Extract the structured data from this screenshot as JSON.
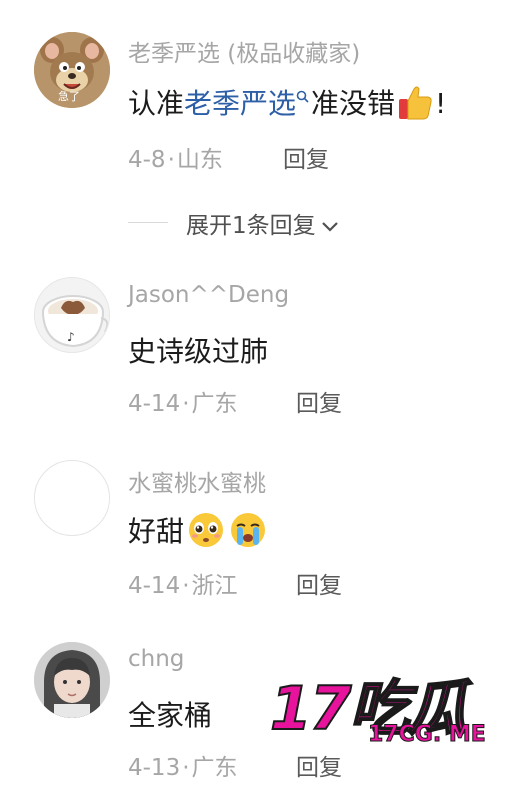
{
  "comments": [
    {
      "username": "老季严选 (极品收藏家)",
      "text_pre": "认准",
      "text_link": "老季严选",
      "text_post": "准没错",
      "text_end": "!",
      "date": "4-8",
      "location": "山东",
      "reply_label": "回复",
      "avatar_caption": "急了",
      "emoji_icon": "thumbs-up-icon"
    },
    {
      "username": "Jason^^Deng",
      "text": "史诗级过肺",
      "date": "4-14",
      "location": "广东",
      "reply_label": "回复"
    },
    {
      "username": "水蜜桃水蜜桃",
      "text": "好甜",
      "date": "4-14",
      "location": "浙江",
      "reply_label": "回复",
      "emoji_icons": [
        "pleading-face-icon",
        "crying-face-icon"
      ]
    },
    {
      "username": "chng",
      "text": "全家桶",
      "date": "4-13",
      "location": "广东",
      "reply_label": "回复"
    }
  ],
  "expand": {
    "label": "展开1条回复"
  },
  "watermark": {
    "big": "17吃瓜",
    "small": "17CG. ME"
  },
  "colors": {
    "link": "#2d5fa6",
    "meta": "#a6a6a6",
    "watermark": "#e8139c",
    "watermark_stroke": "#1a1a1a"
  }
}
